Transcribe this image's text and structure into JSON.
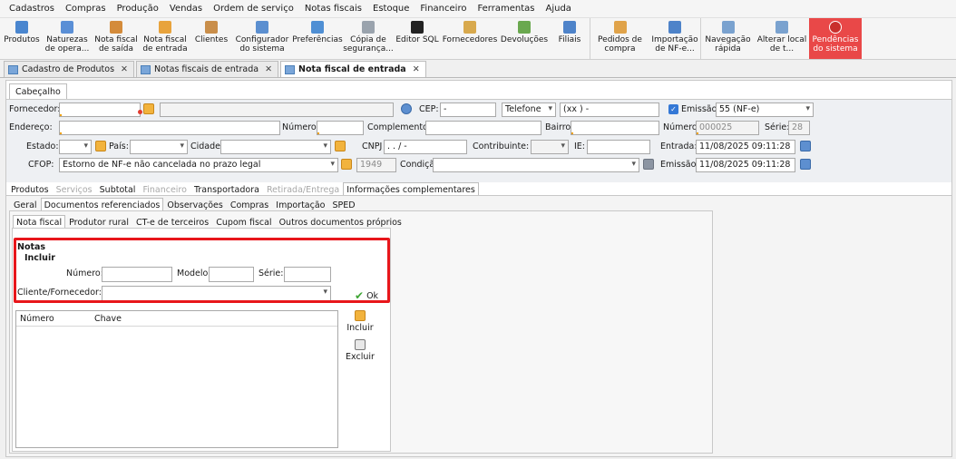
{
  "menu": [
    "Cadastros",
    "Compras",
    "Produção",
    "Vendas",
    "Ordem de serviço",
    "Notas fiscais",
    "Estoque",
    "Financeiro",
    "Ferramentas",
    "Ajuda"
  ],
  "toolbar": [
    {
      "l1": "Produtos",
      "l2": "",
      "icon": "products-icon",
      "color": "#4a86cf"
    },
    {
      "l1": "Naturezas",
      "l2": "de opera...",
      "icon": "grid-icon",
      "color": "#5a8fd6"
    },
    {
      "l1": "Nota fiscal",
      "l2": "de saída",
      "icon": "invoice-out-icon",
      "color": "#d48b3a"
    },
    {
      "l1": "Nota fiscal",
      "l2": "de entrada",
      "icon": "invoice-in-icon",
      "color": "#e8a33c"
    },
    {
      "l1": "Clientes",
      "l2": "",
      "icon": "clients-icon",
      "color": "#c98e4a"
    },
    {
      "l1": "Configurador",
      "l2": "do sistema",
      "icon": "configurator-icon",
      "color": "#5b8fd0"
    },
    {
      "l1": "Preferências",
      "l2": "",
      "icon": "preferences-icon",
      "color": "#4f8fd4"
    },
    {
      "l1": "Cópia de",
      "l2": "segurança...",
      "icon": "backup-icon",
      "color": "#9aa3ad"
    },
    {
      "l1": "Editor SQL",
      "l2": "",
      "icon": "sql-icon",
      "color": "#222222"
    },
    {
      "l1": "Fornecedores",
      "l2": "",
      "icon": "suppliers-icon",
      "color": "#d8a94d"
    },
    {
      "l1": "Devoluções",
      "l2": "",
      "icon": "returns-icon",
      "color": "#6aa84f"
    },
    {
      "l1": "Filiais",
      "l2": "",
      "icon": "branches-icon",
      "color": "#4e83c9"
    },
    {
      "l1": "Pedidos de",
      "l2": "compra",
      "icon": "purchase-orders-icon",
      "color": "#e0a34a"
    },
    {
      "l1": "Importação",
      "l2": "de NF-e...",
      "icon": "import-nfe-icon",
      "color": "#4e83c9"
    },
    {
      "l1": "Navegação",
      "l2": "rápida",
      "icon": "quick-nav-icon",
      "color": "#7aa2cf"
    },
    {
      "l1": "Alterar local",
      "l2": "de t...",
      "icon": "change-location-icon",
      "color": "#7aa2cf"
    },
    {
      "l1": "Pendências",
      "l2": "do sistema",
      "icon": "pending-icon",
      "color": "#c9302c"
    }
  ],
  "doc_tabs": [
    "Cadastro de Produtos",
    "Notas fiscais de entrada",
    "Nota fiscal de entrada"
  ],
  "header_tab": "Cabeçalho",
  "form": {
    "fornecedor_label": "Fornecedor:",
    "cep_label": "CEP:",
    "cep_value": "-",
    "telefone_select": "Telefone",
    "telefone_value": "(xx )  -",
    "emissao_check_label": "Emissão",
    "emissao_select": "55 (NF-e)",
    "endereco_label": "Endereço:",
    "numero_label": "Número:",
    "complemento_label": "Complemento:",
    "bairro_label": "Bairro:",
    "numero_nf_label": "Número:",
    "numero_nf_value": "000025",
    "serie_label": "Série:",
    "serie_value": "28",
    "estado_label": "Estado:",
    "pais_label": "País:",
    "cidade_label": "Cidade:",
    "cnpj_label": "CNPJ",
    "cnpj_value": " .  .  /  -",
    "contribuinte_label": "Contribuinte:",
    "ie_label": "IE:",
    "entrada_label": "Entrada:",
    "entrada_value": "11/08/2025 09:11:28",
    "cfop_label": "CFOP:",
    "cfop_value": "Estorno de NF-e não cancelada no prazo legal",
    "cfop_code": "1949",
    "condicao_label": "Condição:",
    "emissao_label": "Emissão:",
    "emissao_value": "11/08/2025 09:11:28"
  },
  "tabs_level1": [
    {
      "label": "Produtos",
      "state": "normal"
    },
    {
      "label": "Serviços",
      "state": "dim"
    },
    {
      "label": "Subtotal",
      "state": "normal"
    },
    {
      "label": "Financeiro",
      "state": "dim"
    },
    {
      "label": "Transportadora",
      "state": "normal"
    },
    {
      "label": "Retirada/Entrega",
      "state": "dim"
    },
    {
      "label": "Informações complementares",
      "state": "on"
    }
  ],
  "tabs_level2": [
    {
      "label": "Geral",
      "state": "normal"
    },
    {
      "label": "Documentos referenciados",
      "state": "on"
    },
    {
      "label": "Observações",
      "state": "normal"
    },
    {
      "label": "Compras",
      "state": "normal"
    },
    {
      "label": "Importação",
      "state": "normal"
    },
    {
      "label": "SPED",
      "state": "normal"
    }
  ],
  "tabs_level3": [
    {
      "label": "Nota fiscal",
      "state": "on"
    },
    {
      "label": "Produtor rural",
      "state": "normal"
    },
    {
      "label": "CT-e de terceiros",
      "state": "normal"
    },
    {
      "label": "Cupom fiscal",
      "state": "normal"
    },
    {
      "label": "Outros documentos próprios",
      "state": "normal"
    }
  ],
  "notas": {
    "title": "Notas",
    "incluir_title": "Incluir",
    "numero_label": "Número:",
    "modelo_label": "Modelo:",
    "serie_label": "Série:",
    "cliente_label": "Cliente/Fornecedor:",
    "ok_label": "Ok",
    "grid_headers": [
      "Número",
      "Chave"
    ],
    "incluir_button": "Incluir",
    "excluir_button": "Excluir"
  },
  "colors": {
    "accent": "#3478d6",
    "alert": "#e94848",
    "highlight": "#e8161b",
    "ok": "#3fa535"
  }
}
